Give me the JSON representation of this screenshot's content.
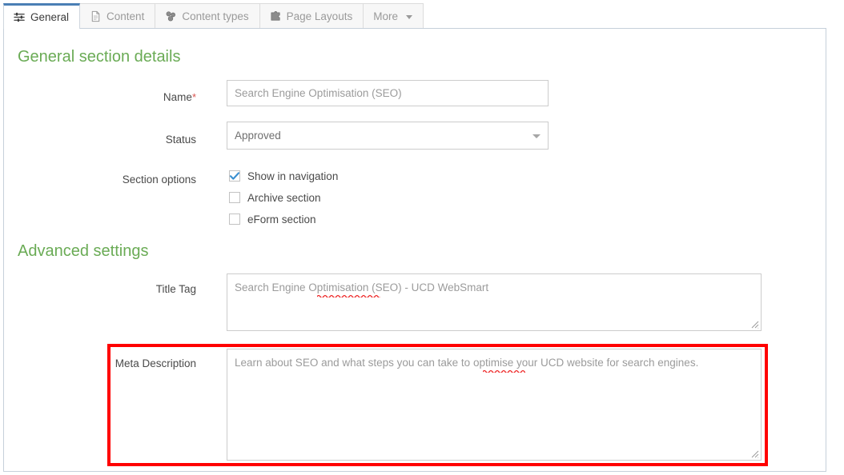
{
  "tabs": [
    {
      "label": "General",
      "icon": "sliders-icon",
      "active": true
    },
    {
      "label": "Content",
      "icon": "document-icon",
      "active": false
    },
    {
      "label": "Content types",
      "icon": "blocks-icon",
      "active": false
    },
    {
      "label": "Page Layouts",
      "icon": "puzzle-piece-icon",
      "active": false
    },
    {
      "label": "More",
      "icon": "chevron-down-icon",
      "active": false
    }
  ],
  "general_section": {
    "heading": "General section details",
    "name": {
      "label": "Name",
      "required_marker": "*",
      "value": "Search Engine Optimisation (SEO)"
    },
    "status": {
      "label": "Status",
      "value": "Approved",
      "options": [
        "Approved"
      ]
    },
    "section_options": {
      "label": "Section options",
      "items": [
        {
          "label": "Show in navigation",
          "checked": true
        },
        {
          "label": "Archive section",
          "checked": false
        },
        {
          "label": "eForm section",
          "checked": false
        }
      ]
    }
  },
  "advanced_section": {
    "heading": "Advanced settings",
    "title_tag": {
      "label": "Title Tag",
      "value": "Search Engine Optimisation (SEO) - UCD WebSmart"
    },
    "meta_description": {
      "label": "Meta Description",
      "value": "Learn about SEO and what steps you can take to optimise your UCD website for search engines."
    }
  },
  "annotation": {
    "highlight_color": "#ff0000",
    "target": "meta-description-field"
  },
  "colors": {
    "heading_green": "#6aab55",
    "active_tab_blue": "#4a7fb5",
    "required_red": "#d9534f",
    "checkbox_blue": "#3a8fd0",
    "spellcheck_red": "#ee2222"
  }
}
